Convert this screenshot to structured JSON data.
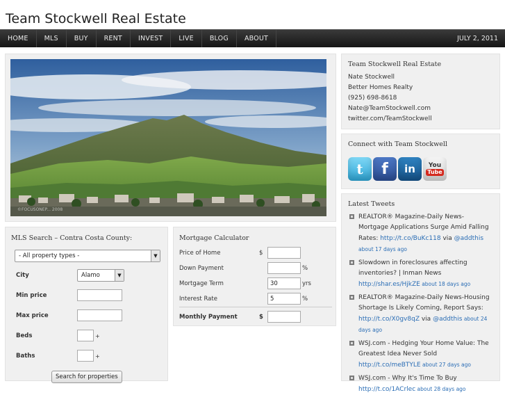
{
  "site": {
    "title": "Team Stockwell Real Estate"
  },
  "nav": {
    "items": [
      "HOME",
      "MLS",
      "BUY",
      "RENT",
      "INVEST",
      "LIVE",
      "BLOG",
      "ABOUT"
    ],
    "date": "JULY 2, 2011"
  },
  "hero": {
    "credit": "©FOCUSONEP... 2008"
  },
  "contact": {
    "heading": "Team Stockwell Real Estate",
    "lines": [
      "Nate Stockwell",
      "Better Homes Realty",
      "(925) 698-8618",
      "Nate@TeamStockwell.com",
      "twitter.com/TeamStockwell"
    ]
  },
  "connect": {
    "heading": "Connect with Team Stockwell",
    "icons": [
      {
        "name": "twitter-icon",
        "glyph": "t"
      },
      {
        "name": "facebook-icon",
        "glyph": "f"
      },
      {
        "name": "linkedin-icon",
        "glyph": "in"
      },
      {
        "name": "youtube-icon",
        "you": "You",
        "tube": "Tube"
      }
    ]
  },
  "tweets": {
    "heading": "Latest Tweets",
    "items": [
      {
        "text": "REALTOR® Magazine-Daily News-Mortgage Applications Surge Amid Falling Rates: ",
        "link": "http://t.co/BuKc118",
        "via": " via ",
        "user": "@addthis",
        "age": " about 17 days ago"
      },
      {
        "text": "Slowdown in foreclosures affecting inventories? | Inman News ",
        "link": "http://shar.es/HjkZE",
        "via": "",
        "user": "",
        "age": " about 18 days ago"
      },
      {
        "text": "REALTOR® Magazine-Daily News-Housing Shortage Is Likely Coming, Report Says: ",
        "link": "http://t.co/X0gv8qZ",
        "via": " via ",
        "user": "@addthis",
        "age": " about 24 days ago"
      },
      {
        "text": "WSJ.com - Hedging Your Home Value: The Greatest Idea Never Sold ",
        "link": "http://t.co/meBTYLE",
        "via": "",
        "user": "",
        "age": " about 27 days ago"
      },
      {
        "text": "WSJ.com - Why It's Time To Buy ",
        "link": "http://t.co/1ACrlec",
        "via": "",
        "user": "",
        "age": " about 28 days ago"
      }
    ]
  },
  "mls": {
    "heading": "MLS Search – Contra Costa County:",
    "property_type": "- All property types -",
    "city_label": "City",
    "city_value": "Alamo",
    "min_price_label": "Min price",
    "max_price_label": "Max price",
    "beds_label": "Beds",
    "baths_label": "Baths",
    "plus": "+",
    "search_button": "Search for properties"
  },
  "calculator": {
    "heading": "Mortgage Calculator",
    "price_label": "Price of Home",
    "down_label": "Down Payment",
    "term_label": "Mortgage Term",
    "rate_label": "Interest Rate",
    "payment_label": "Monthly Payment",
    "currency": "$",
    "percent": "%",
    "years": "yrs",
    "term_value": "30",
    "rate_value": "5"
  }
}
